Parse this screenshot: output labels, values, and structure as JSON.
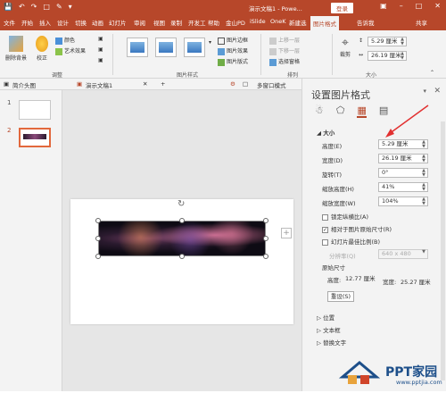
{
  "titlebar": {
    "doc_title": "演示文稿1 - Powe...",
    "login_label": "登录",
    "icons": [
      "save-icon",
      "undo-icon",
      "redo-icon",
      "start-icon",
      "highlight-icon",
      "more-icon"
    ]
  },
  "tabs": [
    "文件",
    "开始",
    "插入",
    "设计",
    "切换",
    "动画",
    "幻灯片",
    "审阅",
    "视图",
    "录制",
    "开发工",
    "帮助",
    "金山PD",
    "iSlide",
    "OneK",
    "新建选",
    "图片格式",
    "告诉我",
    "共享"
  ],
  "active_tab": "图片格式",
  "ribbon": {
    "remove_bg": "删除背景",
    "correct": "校正",
    "color": "颜色",
    "art_effect": "艺术效果",
    "adjust_group": "调整",
    "picture_styles_group": "图片样式",
    "border": "图片边框",
    "effect": "图片效果",
    "layout": "图片版式",
    "bring_forward": "上移一层",
    "send_backward": "下移一层",
    "selection_pane": "选择窗格",
    "arrange_group": "排列",
    "crop": "裁剪",
    "height_value": "5.29 厘米",
    "width_value": "26.19 厘米",
    "size_group": "大小"
  },
  "doctabs": {
    "tab1": "简介头图",
    "tab2": "演示文稿1",
    "tab3": "多窗口模式"
  },
  "slides": [
    "1",
    "2"
  ],
  "pane": {
    "title": "设置图片格式",
    "size_section": "大小",
    "height_label": "高度(E)",
    "height_value": "5.29 厘米",
    "width_label": "宽度(D)",
    "width_value": "26.19 厘米",
    "rotate_label": "旋转(T)",
    "rotate_value": "0°",
    "scale_h_label": "缩放高度(H)",
    "scale_h_value": "41%",
    "scale_w_label": "缩放宽度(W)",
    "scale_w_value": "104%",
    "lock_ratio": "锁定纵横比(A)",
    "relative_size": "相对于图片原始尺寸(R)",
    "best_scale": "幻灯片最佳比例(B)",
    "resolution_label": "分辨率(Q)",
    "resolution_value": "640 x 480",
    "original_size": "原始尺寸",
    "orig_height_label": "高度:",
    "orig_height_value": "12.77 厘米",
    "orig_width_label": "宽度:",
    "orig_width_value": "25.27 厘米",
    "reset_label": "重设(S)",
    "position_section": "位置",
    "textbox_section": "文本框",
    "alt_text_section": "替换文字"
  },
  "watermark": {
    "brand": "PPT家园",
    "url": "www.pptjia.com"
  },
  "colors": {
    "accent": "#b7472a",
    "arrow": "#e23030",
    "watermark": "#1d4f8a"
  }
}
